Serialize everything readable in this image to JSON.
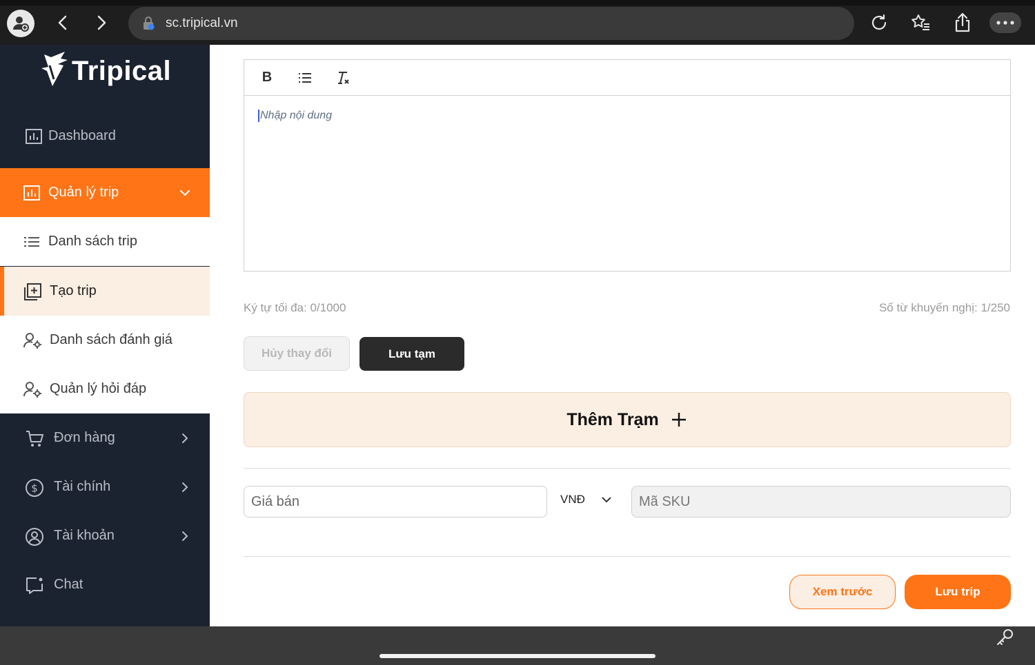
{
  "browser": {
    "url": "sc.tripical.vn",
    "icons": [
      "profile-icon",
      "back-icon",
      "forward-icon",
      "lock-icon",
      "reload-icon",
      "favorites-icon",
      "share-icon",
      "more-icon"
    ]
  },
  "brand": {
    "name": "Tripical",
    "accent": "#fe7416",
    "sidebar_bg": "#1c2330"
  },
  "sidebar": {
    "items": [
      {
        "label": "Dashboard",
        "icon": "chart-icon"
      },
      {
        "label": "Quản lý trip",
        "icon": "chart-icon",
        "expanded": true
      },
      {
        "label": "Danh sách trip",
        "icon": "list-icon"
      },
      {
        "label": "Tạo trip",
        "icon": "add-square-icon",
        "selected": true
      },
      {
        "label": "Danh sách đánh giá",
        "icon": "user-gear-icon"
      },
      {
        "label": "Quản lý hỏi đáp",
        "icon": "user-gear-icon"
      },
      {
        "label": "Đơn hàng",
        "icon": "cart-icon"
      },
      {
        "label": "Tài chính",
        "icon": "dollar-icon"
      },
      {
        "label": "Tài khoản",
        "icon": "user-circle-icon"
      },
      {
        "label": "Chat",
        "icon": "chat-icon"
      }
    ]
  },
  "editor": {
    "toolbar": [
      "bold-icon",
      "list-icon",
      "clear-format-icon"
    ],
    "bold_label": "B",
    "placeholder": "Nhập nội dung",
    "max_chars_label": "Ký tự tối đa:",
    "max_chars_value": "0/1000",
    "recommended_words_label": "Số từ khuyến nghị:",
    "recommended_words_value": "1/250"
  },
  "actions": {
    "cancel_label": "Hủy thay đổi",
    "save_draft_label": "Lưu tạm",
    "add_station_label": "Thêm Trạm",
    "preview_label": "Xem trước",
    "save_trip_label": "Lưu trip"
  },
  "pricing": {
    "price_placeholder": "Giá bán",
    "currency": "VNĐ",
    "sku_placeholder": "Mã SKU"
  }
}
